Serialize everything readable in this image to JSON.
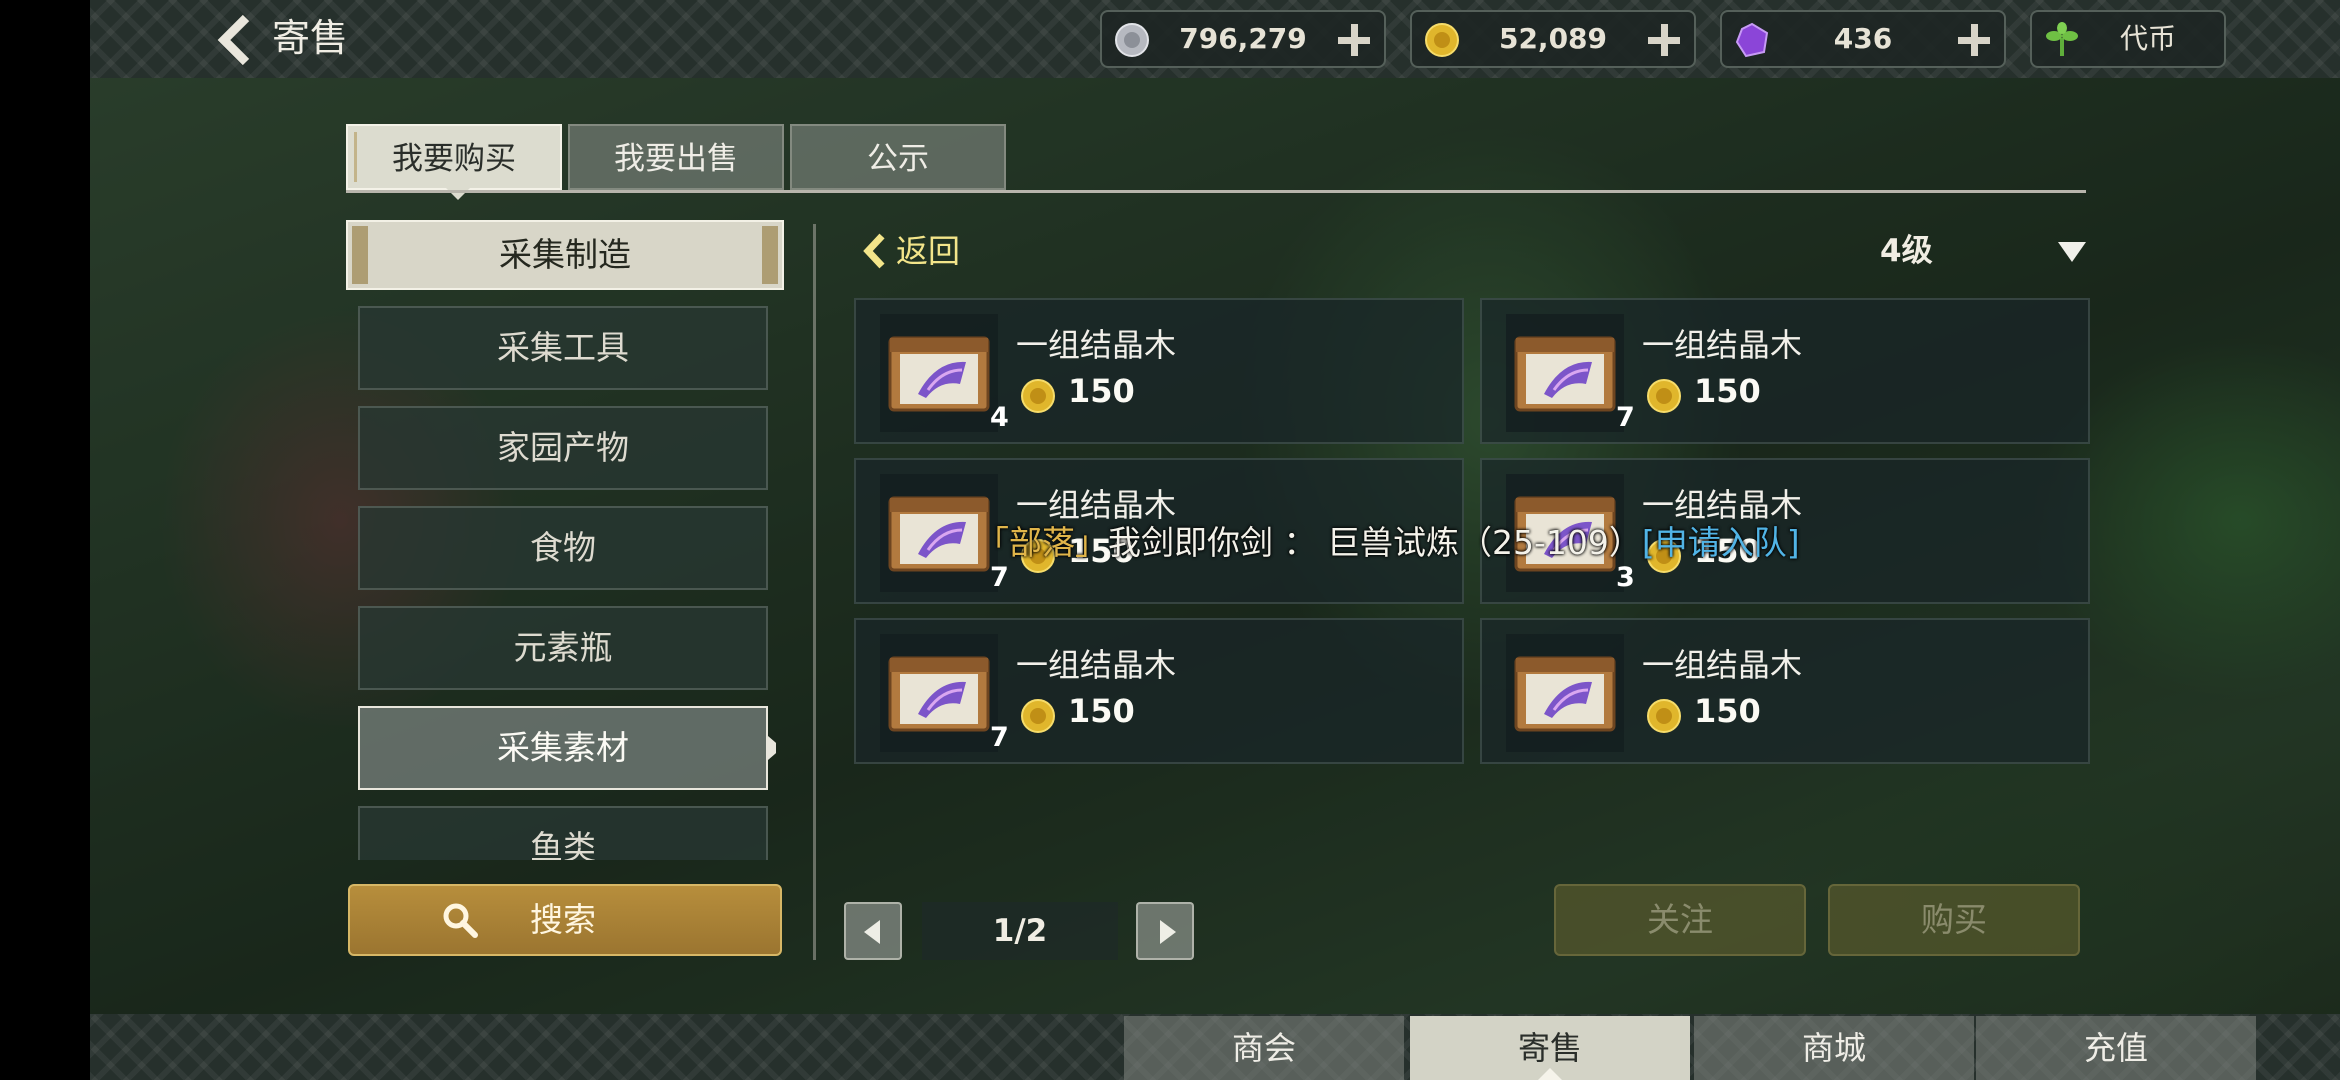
{
  "header": {
    "title": "寄售"
  },
  "currencies": [
    {
      "icon": "silver-coin-icon",
      "value": "796,279"
    },
    {
      "icon": "gold-coin-icon",
      "value": "52,089"
    },
    {
      "icon": "purple-crystal-icon",
      "value": "436"
    },
    {
      "icon": "sprout-icon",
      "value": "代币"
    }
  ],
  "tabs": [
    {
      "label": "我要购买",
      "active": true
    },
    {
      "label": "我要出售",
      "active": false
    },
    {
      "label": "公示",
      "active": false
    }
  ],
  "category": {
    "header": "采集制造",
    "items": [
      "采集工具",
      "家园产物",
      "食物",
      "元素瓶",
      "采集素材",
      "鱼类"
    ],
    "selected": "采集素材"
  },
  "search_label": "搜索",
  "listing": {
    "back_label": "返回",
    "level": "4级",
    "items": [
      {
        "name": "一组结晶木",
        "price": "150",
        "qty": "4"
      },
      {
        "name": "一组结晶木",
        "price": "150",
        "qty": "7"
      },
      {
        "name": "一组结晶木",
        "price": "150",
        "qty": "7"
      },
      {
        "name": "一组结晶木",
        "price": "150",
        "qty": "3"
      },
      {
        "name": "一组结晶木",
        "price": "150",
        "qty": "7"
      },
      {
        "name": "一组结晶木",
        "price": "150",
        "qty": ""
      }
    ]
  },
  "chat": {
    "channel": "「部落」",
    "message": "我剑即你剑 ： 巨兽试炼（25-109）",
    "action": "[申请入队]"
  },
  "pagination": {
    "text": "1/2"
  },
  "actions": {
    "follow": "关注",
    "buy": "购买"
  },
  "bottom_nav": [
    {
      "label": "商会",
      "active": false
    },
    {
      "label": "寄售",
      "active": true
    },
    {
      "label": "商城",
      "active": false
    },
    {
      "label": "充值",
      "active": false
    }
  ]
}
